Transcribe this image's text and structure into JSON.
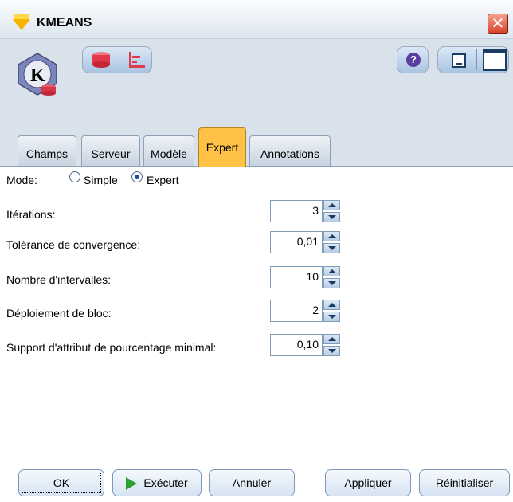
{
  "window": {
    "title": "KMEANS",
    "close_glyph": "✕",
    "accent": "#ffc247"
  },
  "logo": {
    "letter": "K"
  },
  "toolbar": {
    "help_glyph": "?"
  },
  "tabs": [
    {
      "label": "Champs"
    },
    {
      "label": "Serveur"
    },
    {
      "label": "Modèle"
    },
    {
      "label": "Expert"
    },
    {
      "label": "Annotations"
    }
  ],
  "mode": {
    "label": "Mode:",
    "options": [
      "Simple",
      "Expert"
    ],
    "selected": "Expert"
  },
  "fields": [
    {
      "label": "Itérations:",
      "value": "3"
    },
    {
      "label": "Tolérance de convergence:",
      "value": "0,01"
    },
    {
      "label": "Nombre d'intervalles:",
      "value": "10"
    },
    {
      "label": "Déploiement de bloc:",
      "value": "2"
    },
    {
      "label": "Support d'attribut de pourcentage minimal:",
      "value": "0,10"
    }
  ],
  "buttons": {
    "ok": "OK",
    "run": "Exécuter",
    "cancel": "Annuler",
    "apply": "Appliquer",
    "reset": "Réinitialiser"
  }
}
